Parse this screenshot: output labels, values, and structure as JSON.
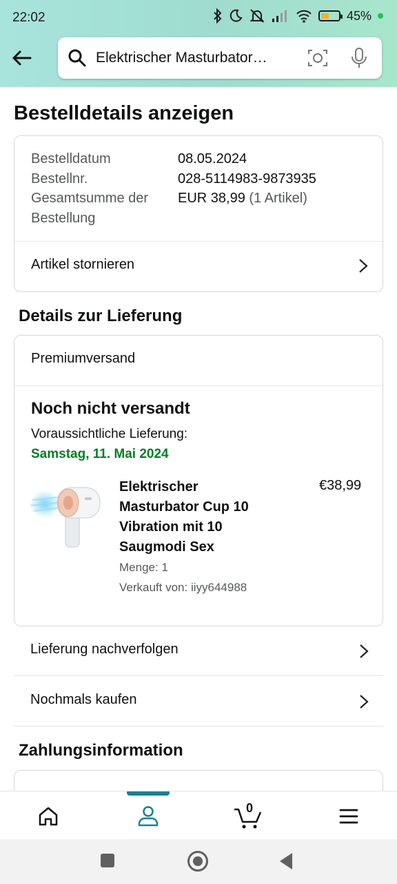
{
  "status_bar": {
    "time": "22:02",
    "battery_pct": "45%",
    "battery_level": 0.45
  },
  "search": {
    "query": "Elektrischer Masturbator…"
  },
  "page": {
    "title": "Bestelldetails anzeigen"
  },
  "order": {
    "date_label": "Bestelldatum",
    "date_value": "08.05.2024",
    "number_label": "Bestellnr.",
    "number_value": "028-5114983-9873935",
    "total_label_line1": "Gesamtsumme der",
    "total_label_line2": "Bestellung",
    "total_value": "EUR 38,99",
    "total_items": "(1 Artikel)",
    "cancel_label": "Artikel stornieren"
  },
  "delivery": {
    "heading": "Details zur Lieferung",
    "shipping_method": "Premiumversand",
    "status": "Noch nicht versandt",
    "expected_label": "Voraussichtliche Lieferung:",
    "expected_date": "Samstag, 11. Mai 2024",
    "product": {
      "name_line1": "Elektrischer",
      "name_line2": "Masturbator Cup 10",
      "name_line3": "Vibration mit 10",
      "name_line4": "Saugmodi Sex",
      "price": "€38,99",
      "quantity": "Menge: 1",
      "seller": "Verkauft von: iiyy644988"
    },
    "track_label": "Lieferung nachverfolgen",
    "buy_again_label": "Nochmals kaufen"
  },
  "payment": {
    "heading": "Zahlungsinformation"
  },
  "bottom_nav": {
    "cart_count": "0"
  },
  "colors": {
    "accent": "#1a8091",
    "delivery_green": "#067d25",
    "header_gradient": "#a8e4dc"
  }
}
